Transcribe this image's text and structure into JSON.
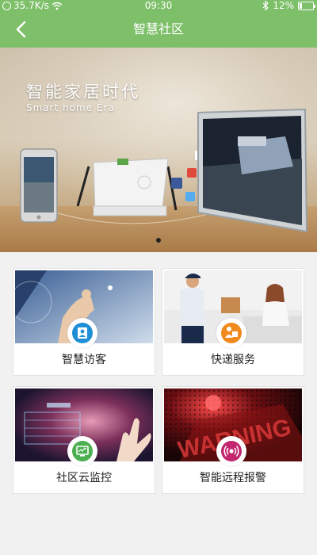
{
  "status_bar": {
    "network_speed": "35.7K/s",
    "time": "09:30",
    "battery": "12%"
  },
  "nav": {
    "title": "智慧社区"
  },
  "banner": {
    "title": "智能家居时代",
    "subtitle": "Smart home Era",
    "active_slide": 1,
    "slide_count": 1
  },
  "services": [
    {
      "label": "智慧访客",
      "icon": "visitor-id-icon",
      "badge_color": "#1e8fd6"
    },
    {
      "label": "快递服务",
      "icon": "courier-delivery-icon",
      "badge_color": "#f08a1c"
    },
    {
      "label": "社区云监控",
      "icon": "monitor-icon",
      "badge_color": "#4caf50"
    },
    {
      "label": "智能远程报警",
      "icon": "alarm-signal-icon",
      "badge_color": "#c2266e"
    }
  ],
  "colors": {
    "header": "#7ebf6a",
    "page_background": "#f1f1f1"
  }
}
